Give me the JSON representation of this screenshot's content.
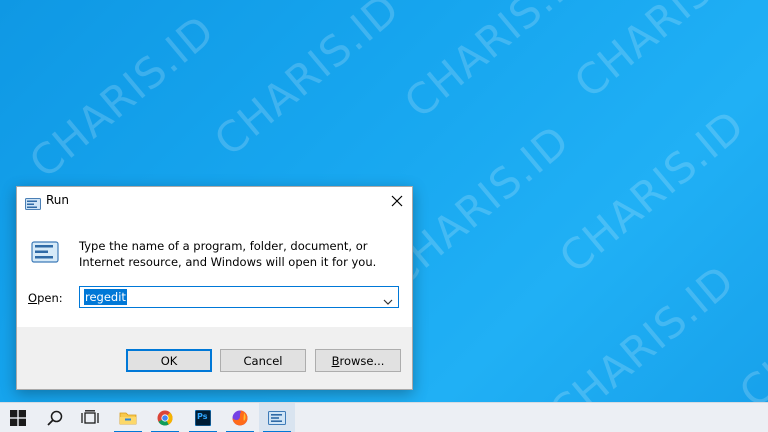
{
  "watermark": {
    "text": "CHARIS.ID"
  },
  "run_dialog": {
    "title": "Run",
    "description": "Type the name of a program, folder, document, or Internet resource, and Windows will open it for you.",
    "open_label_accel": "O",
    "open_label_rest": "pen:",
    "open_value": "regedit",
    "ok_label": "OK",
    "cancel_label": "Cancel",
    "browse_label_accel": "B",
    "browse_label_rest": "rowse..."
  },
  "taskbar": {
    "items": [
      {
        "name": "start",
        "icon": "windows-logo-icon"
      },
      {
        "name": "search",
        "icon": "search-icon"
      },
      {
        "name": "task-view",
        "icon": "task-view-icon"
      },
      {
        "name": "file-explorer",
        "icon": "folder-icon"
      },
      {
        "name": "chrome",
        "icon": "chrome-icon"
      },
      {
        "name": "photoshop",
        "icon": "photoshop-icon",
        "label": "Ps"
      },
      {
        "name": "firefox",
        "icon": "firefox-icon"
      },
      {
        "name": "run",
        "icon": "run-icon"
      }
    ]
  },
  "colors": {
    "accent": "#0078d7",
    "desktop": "#17a6ef"
  }
}
